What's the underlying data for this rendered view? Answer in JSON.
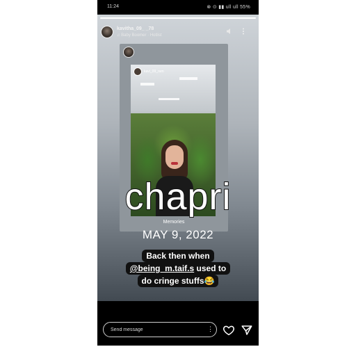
{
  "status_bar": {
    "time": "11:24",
    "right_text": "⊗ ⊙ ▮▮ ull ull 55%"
  },
  "story": {
    "progress_fraction": 1.0,
    "username": "kavitha_09_ _78",
    "subline": "♫ Baby Boomer · Hotlist"
  },
  "memory_card": {
    "inner_username": "kavi_09_ram",
    "memories_label": "Memories"
  },
  "overlay": {
    "word": "chapri",
    "date": "MAY 9, 2022"
  },
  "caption": {
    "line1": "Back then when",
    "line2_mention": "@being_m.taif.s",
    "line2_rest": " used to",
    "line3": "do cringe stuffs😂"
  },
  "reply": {
    "placeholder": "Send message",
    "more_icon": "more-vertical-icon",
    "like_icon": "heart-icon",
    "share_icon": "send-icon"
  }
}
